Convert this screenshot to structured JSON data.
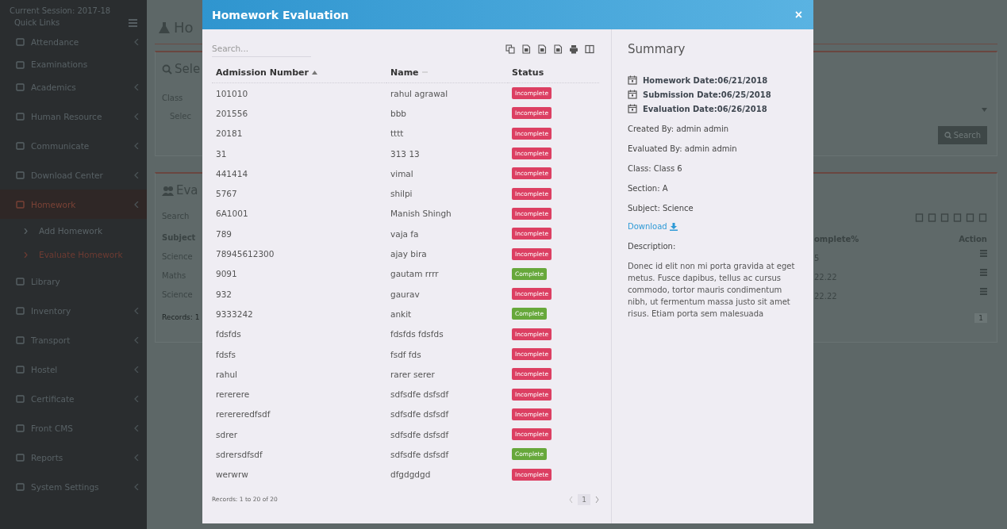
{
  "sidebar": {
    "session": "Current Session: 2017-18",
    "quick_links": "Quick Links",
    "items": [
      {
        "label": "Attendance",
        "kind": "menu",
        "selected": false
      },
      {
        "label": "Examinations",
        "kind": "link",
        "selected": false
      },
      {
        "label": "Academics",
        "kind": "menu",
        "selected": false
      },
      {
        "label": "Human Resource",
        "kind": "menu",
        "selected": false
      },
      {
        "label": "Communicate",
        "kind": "menu",
        "selected": false
      },
      {
        "label": "Download Center",
        "kind": "menu",
        "selected": false
      },
      {
        "label": "Homework",
        "kind": "menu",
        "selected": true,
        "children": [
          {
            "label": "Add Homework",
            "selected": false
          },
          {
            "label": "Evaluate Homework",
            "selected": true
          }
        ]
      },
      {
        "label": "Library",
        "kind": "link",
        "selected": false
      },
      {
        "label": "Inventory",
        "kind": "menu",
        "selected": false
      },
      {
        "label": "Transport",
        "kind": "menu",
        "selected": false
      },
      {
        "label": "Hostel",
        "kind": "menu",
        "selected": false
      },
      {
        "label": "Certificate",
        "kind": "menu",
        "selected": false
      },
      {
        "label": "Front CMS",
        "kind": "menu",
        "selected": false
      },
      {
        "label": "Reports",
        "kind": "menu",
        "selected": false
      },
      {
        "label": "System Settings",
        "kind": "menu",
        "selected": false
      }
    ]
  },
  "page": {
    "title": "Ho",
    "select_panel": {
      "title": "Sele",
      "class_label": "Class",
      "class_select": "Selec",
      "search_button": "Search"
    },
    "list_panel": {
      "title": "Eva",
      "search": "Search",
      "columns": [
        "Subject",
        "omplete%",
        "Action"
      ],
      "rows": [
        {
          "subject": "Science",
          "percent": "5"
        },
        {
          "subject": "Maths",
          "percent": "22.22"
        },
        {
          "subject": "Science",
          "percent": "22.22"
        }
      ],
      "records": "Records: 1",
      "page": "1"
    }
  },
  "modal": {
    "title": "Homework Evaluation",
    "close": "×",
    "search_placeholder": "Search...",
    "columns": [
      {
        "label": "Admission Number",
        "sorted": true
      },
      {
        "label": "Name",
        "sorted": false
      },
      {
        "label": "Status"
      }
    ],
    "rows": [
      {
        "admission": "101010",
        "name": "rahul agrawal",
        "status": "Incomplete",
        "complete": false
      },
      {
        "admission": "201556",
        "name": "bbb",
        "status": "Incomplete",
        "complete": false
      },
      {
        "admission": "20181",
        "name": "tttt",
        "status": "Incomplete",
        "complete": false
      },
      {
        "admission": "31",
        "name": "313 13",
        "status": "Incomplete",
        "complete": false
      },
      {
        "admission": "441414",
        "name": "vimal",
        "status": "Incomplete",
        "complete": false
      },
      {
        "admission": "5767",
        "name": "shilpi",
        "status": "Incomplete",
        "complete": false
      },
      {
        "admission": "6A1001",
        "name": "Manish Shingh",
        "status": "Incomplete",
        "complete": false
      },
      {
        "admission": "789",
        "name": "vaja fa",
        "status": "Incomplete",
        "complete": false
      },
      {
        "admission": "78945612300",
        "name": "ajay bira",
        "status": "Incomplete",
        "complete": false
      },
      {
        "admission": "9091",
        "name": "gautam rrrr",
        "status": "Complete",
        "complete": true
      },
      {
        "admission": "932",
        "name": "gaurav",
        "status": "Incomplete",
        "complete": false
      },
      {
        "admission": "9333242",
        "name": "ankit",
        "status": "Complete",
        "complete": true
      },
      {
        "admission": "fdsfds",
        "name": "fdsfds fdsfds",
        "status": "Incomplete",
        "complete": false
      },
      {
        "admission": "fdsfs",
        "name": "fsdf fds",
        "status": "Incomplete",
        "complete": false
      },
      {
        "admission": "rahul",
        "name": "rarer serer",
        "status": "Incomplete",
        "complete": false
      },
      {
        "admission": "rererere",
        "name": "sdfsdfe dsfsdf",
        "status": "Incomplete",
        "complete": false
      },
      {
        "admission": "rerereredfsdf",
        "name": "sdfsdfe dsfsdf",
        "status": "Incomplete",
        "complete": false
      },
      {
        "admission": "sdrer",
        "name": "sdfsdfe dsfsdf",
        "status": "Incomplete",
        "complete": false
      },
      {
        "admission": "sdrersdfsdf",
        "name": "sdfsdfe dsfsdf",
        "status": "Complete",
        "complete": true
      },
      {
        "admission": "werwrw",
        "name": "dfgdgdgd",
        "status": "Incomplete",
        "complete": false
      }
    ],
    "records": "Records: 1 to 20 of 20",
    "page": "1",
    "summary": {
      "title": "Summary",
      "dates": [
        "Homework Date:06/21/2018",
        "Submission Date:06/25/2018",
        "Evaluation Date:06/26/2018"
      ],
      "details": [
        "Created By: admin admin",
        "Evaluated By: admin admin",
        "Class: Class 6",
        "Section: A",
        "Subject: Science"
      ],
      "download": "Download",
      "description_label": "Description:",
      "description": "Donec id elit non mi porta gravida at eget metus. Fusce dapibus, tellus ac cursus commodo, tortor mauris condimentum nibh, ut fermentum massa justo sit amet risus. Etiam porta sem malesuada"
    }
  }
}
